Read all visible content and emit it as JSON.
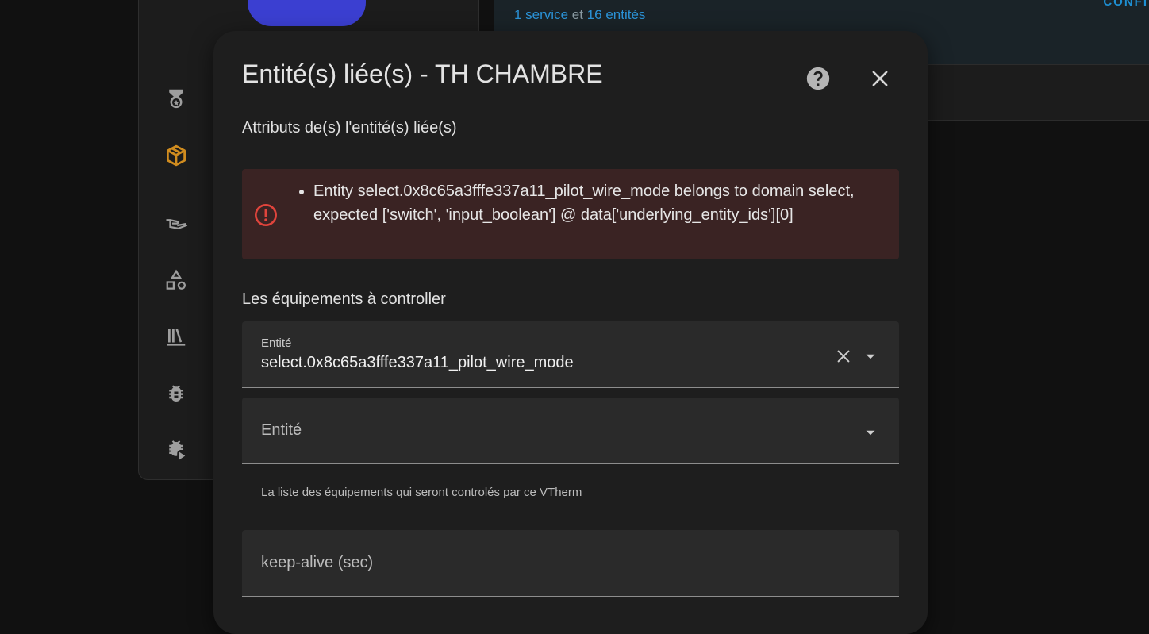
{
  "background": {
    "card_links": {
      "service": "1 service",
      "connector": "et",
      "entities": "16 entités"
    },
    "card_button": "CONFI",
    "nav_icons": [
      "medal-icon",
      "package-icon",
      "hand-icon",
      "shapes-icon",
      "library-icon",
      "bug-icon",
      "bug-play-icon"
    ],
    "accent_color": "#d08c1f"
  },
  "dialog": {
    "title": "Entité(s) liée(s) - TH CHAMBRE",
    "subtitle": "Attributs de(s) l'entité(s) liée(s)",
    "error": {
      "message": "Entity select.0x8c65a3fffe337a11_pilot_wire_mode belongs to domain select, expected ['switch', 'input_boolean'] @ data['underlying_entity_ids'][0]",
      "color": "#e0443c"
    },
    "section_label": "Les équipements à controller",
    "entity_field_1": {
      "label": "Entité",
      "value": "select.0x8c65a3fffe337a11_pilot_wire_mode"
    },
    "entity_field_2": {
      "label": "Entité"
    },
    "helper_text": "La liste des équipements qui seront controlés par ce VTherm",
    "keepalive_field": {
      "label": "keep-alive (sec)"
    }
  }
}
